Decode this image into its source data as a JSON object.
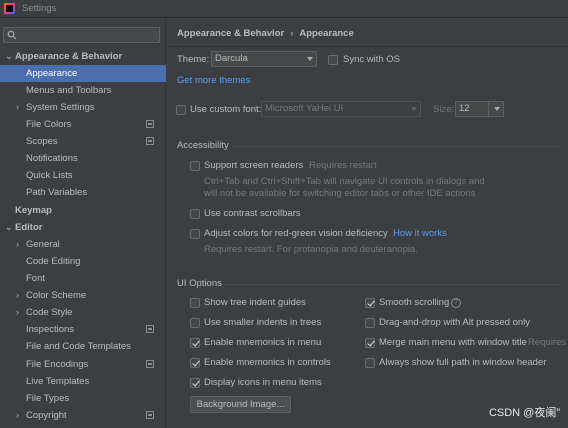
{
  "window": {
    "title": "Settings"
  },
  "search": {
    "placeholder": ""
  },
  "sidebar": {
    "items": [
      {
        "label": "Appearance & Behavior",
        "arrow": "⌄"
      },
      {
        "label": "Appearance"
      },
      {
        "label": "Menus and Toolbars"
      },
      {
        "label": "System Settings",
        "arrow": "›"
      },
      {
        "label": "File Colors"
      },
      {
        "label": "Scopes"
      },
      {
        "label": "Notifications"
      },
      {
        "label": "Quick Lists"
      },
      {
        "label": "Path Variables"
      },
      {
        "label": "Keymap"
      },
      {
        "label": "Editor",
        "arrow": "⌄"
      },
      {
        "label": "General",
        "arrow": "›"
      },
      {
        "label": "Code Editing"
      },
      {
        "label": "Font"
      },
      {
        "label": "Color Scheme",
        "arrow": "›"
      },
      {
        "label": "Code Style",
        "arrow": "›"
      },
      {
        "label": "Inspections"
      },
      {
        "label": "File and Code Templates"
      },
      {
        "label": "File Encodings"
      },
      {
        "label": "Live Templates"
      },
      {
        "label": "File Types"
      },
      {
        "label": "Copyright",
        "arrow": "›"
      }
    ]
  },
  "breadcrumb": {
    "parent": "Appearance & Behavior",
    "separator": "›",
    "current": "Appearance"
  },
  "theme": {
    "label": "Theme:",
    "value": "Darcula",
    "sync_label": "Sync with OS",
    "get_more": "Get more themes"
  },
  "font": {
    "custom_label": "Use custom font:",
    "value": "Microsoft YaHei UI",
    "size_label": "Size:",
    "size_value": "12"
  },
  "accessibility": {
    "title": "Accessibility",
    "screen_readers": "Support screen readers",
    "requires_restart": "Requires restart",
    "screen_readers_desc1": "Ctrl+Tab and Ctrl+Shift+Tab will navigate UI controls in dialogs and",
    "screen_readers_desc2": "will not be available for switching editor tabs or other IDE actions",
    "contrast_scrollbars": "Use contrast scrollbars",
    "adjust_colors": "Adjust colors for red-green vision deficiency",
    "how_it_works": "How it works",
    "adjust_desc": "Requires restart. For protanopia and deuteranopia."
  },
  "ui_options": {
    "title": "UI Options",
    "tree_indent": "Show tree indent guides",
    "smaller_indents": "Use smaller indents in trees",
    "mnemonics_menu": "Enable mnemonics in menu",
    "mnemonics_controls": "Enable mnemonics in controls",
    "icons_in_menu": "Display icons in menu items",
    "smooth_scrolling": "Smooth scrolling",
    "drag_drop": "Drag-and-drop with Alt pressed only",
    "merge_menu": "Merge main menu with window title",
    "merge_requires": "Requires r",
    "full_path": "Always show full path in window header",
    "background_image": "Background Image..."
  },
  "watermark": "CSDN @夜阑”",
  "colors": {
    "accent": "#4b6eaf",
    "link": "#589df6",
    "background": "#3c3f41"
  }
}
